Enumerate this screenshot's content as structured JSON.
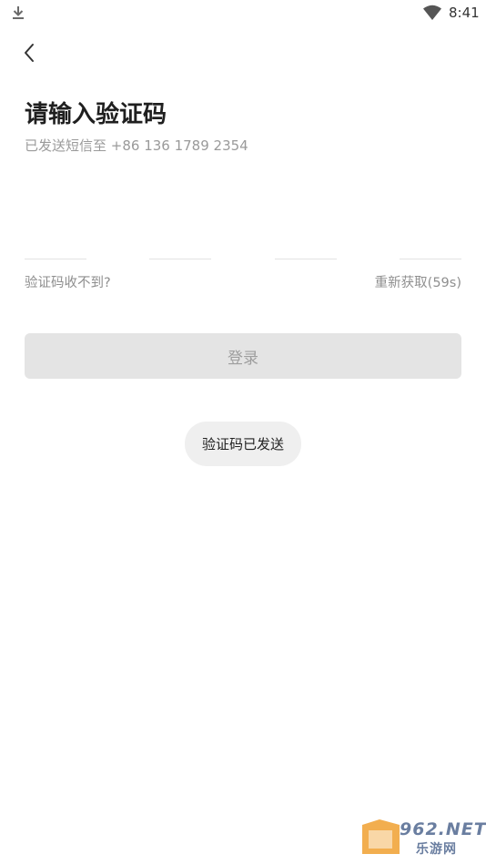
{
  "status_bar": {
    "time": "8:41",
    "left_icon": "download-icon",
    "right_icon": "wifi-icon"
  },
  "header": {
    "back_icon": "chevron-left-icon"
  },
  "page": {
    "title": "请输入验证码",
    "subtitle": "已发送短信至 +86 136 1789 2354"
  },
  "code_inputs": [
    "",
    "",
    "",
    ""
  ],
  "links": {
    "help": "验证码收不到?",
    "resend": "重新获取(59s)"
  },
  "login_button": {
    "label": "登录"
  },
  "toast": {
    "text": "验证码已发送"
  },
  "watermark": {
    "domain": "962.NET",
    "name": "乐游网"
  },
  "colors": {
    "background": "#ffffff",
    "title": "#1f1f1f",
    "secondary_text": "#9a9a9a",
    "button_disabled_bg": "#e4e4e4",
    "button_disabled_text": "#9e9e9e",
    "toast_bg": "#efefef",
    "watermark": "#6a7ea0",
    "watermark_accent": "#f0a030"
  }
}
